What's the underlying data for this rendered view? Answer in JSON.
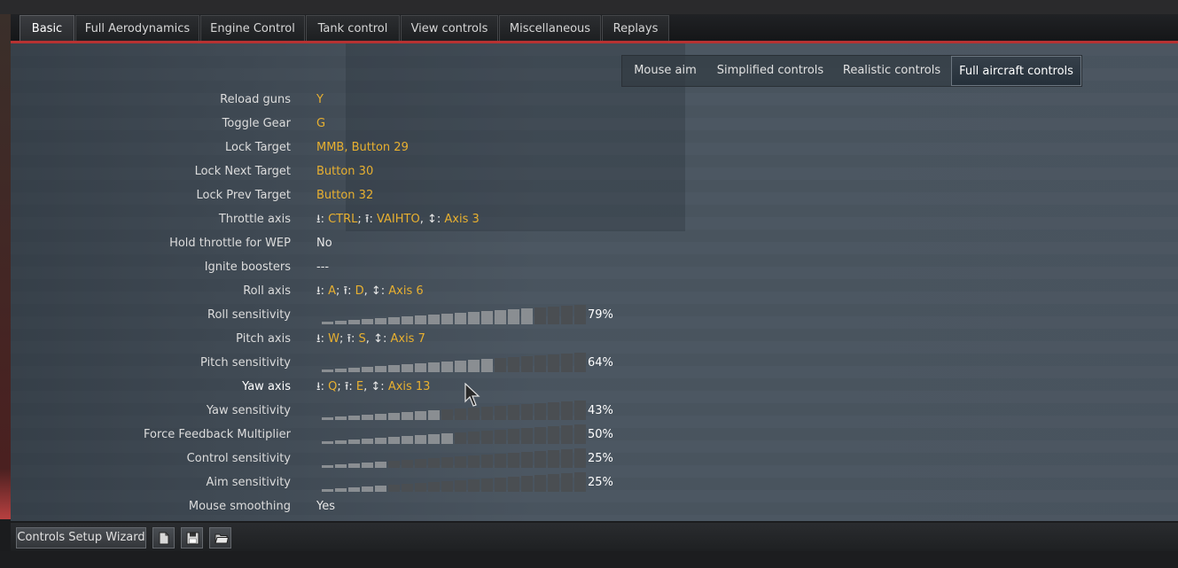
{
  "tabs": [
    {
      "label": "Basic",
      "active": true
    },
    {
      "label": "Full Aerodynamics"
    },
    {
      "label": "Engine Control"
    },
    {
      "label": "Tank control"
    },
    {
      "label": "View controls"
    },
    {
      "label": "Miscellaneous"
    },
    {
      "label": "Replays"
    }
  ],
  "modes": [
    {
      "label": "Mouse aim"
    },
    {
      "label": "Simplified controls"
    },
    {
      "label": "Realistic controls"
    },
    {
      "label": "Full aircraft controls",
      "active": true
    }
  ],
  "rows": [
    {
      "label": "Reload guns",
      "value": "Y"
    },
    {
      "label": "Toggle Gear",
      "value": "G"
    },
    {
      "label": "Lock Target",
      "value": "MMB, Button 29"
    },
    {
      "label": "Lock Next Target",
      "value": "Button 30"
    },
    {
      "label": "Lock Prev Target",
      "value": "Button 32"
    },
    {
      "label": "Throttle axis",
      "axis": {
        "down": "CTRL",
        "up": "VAIHTO",
        "axis": "Axis 3"
      }
    },
    {
      "label": "Hold throttle for WEP",
      "value": "No"
    },
    {
      "label": "Ignite boosters",
      "value": "---"
    },
    {
      "label": "Roll axis",
      "axis": {
        "down": "A",
        "up": "D",
        "axis": "Axis 6"
      }
    },
    {
      "label": "Roll sensitivity",
      "slider": 79,
      "pct": "79%"
    },
    {
      "label": "Pitch axis",
      "axis": {
        "down": "W",
        "up": "S",
        "axis": "Axis 7"
      }
    },
    {
      "label": "Pitch sensitivity",
      "slider": 64,
      "pct": "64%"
    },
    {
      "label": "Yaw axis",
      "axis": {
        "down": "Q",
        "up": "E",
        "axis": "Axis 13"
      },
      "highlight": true
    },
    {
      "label": "Yaw sensitivity",
      "slider": 43,
      "pct": "43%"
    },
    {
      "label": "Force Feedback Multiplier",
      "slider": 50,
      "pct": "50%"
    },
    {
      "label": "Control sensitivity",
      "slider": 25,
      "pct": "25%"
    },
    {
      "label": "Aim sensitivity",
      "slider": 25,
      "pct": "25%"
    },
    {
      "label": "Mouse smoothing",
      "value": "Yes"
    }
  ],
  "glyphs": {
    "down": "⭳",
    "up": "⭱",
    "axis": "↕"
  },
  "bottom": {
    "wizard_label": "Controls Setup Wizard"
  },
  "icons": [
    "new-file-icon",
    "save-icon",
    "open-folder-icon"
  ]
}
